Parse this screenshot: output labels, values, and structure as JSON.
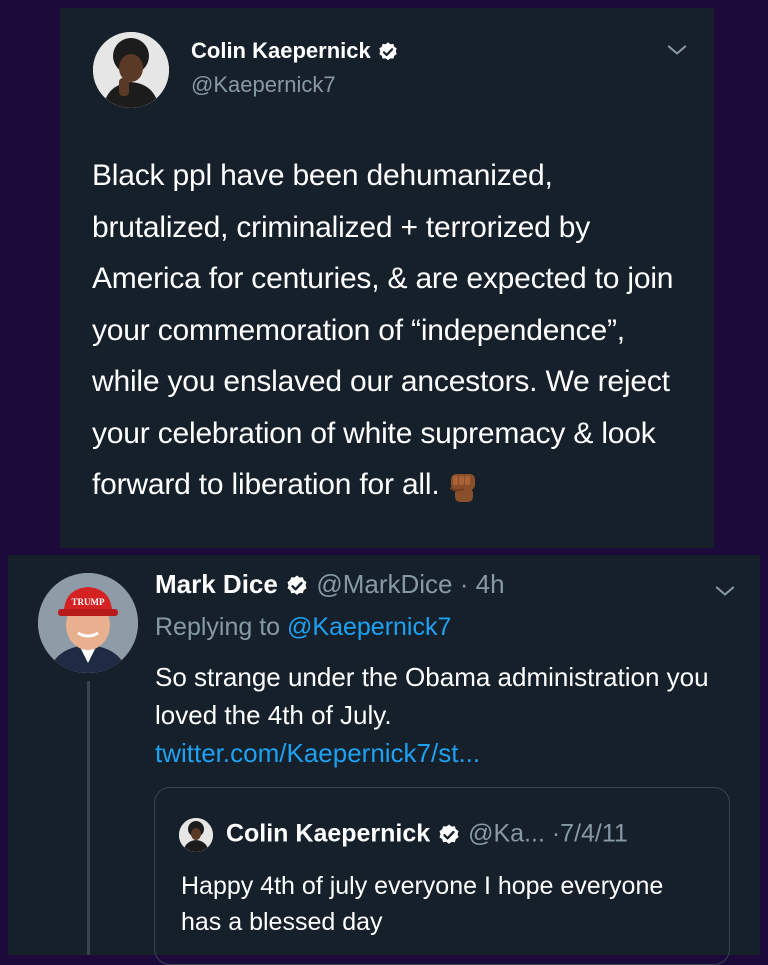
{
  "tweet1": {
    "name": "Colin Kaepernick",
    "handle": "@Kaepernick7",
    "body": "Black ppl have been dehumanized, brutalized, criminalized + terrorized by America for centuries, & are expected to join your commemoration of “independence”, while you enslaved our ancestors. We reject your celebration of white supremacy & look forward to liberation for all.",
    "emoji": "raised-fist-icon"
  },
  "tweet2": {
    "name": "Mark Dice",
    "handle": "@MarkDice",
    "time": "· 4h",
    "replying_prefix": "Replying to ",
    "replying_to": "@Kaepernick7",
    "body": "So strange under the Obama administration you loved the 4th of July.",
    "link": "twitter.com/Kaepernick7/st...",
    "avatar_hat_text": "TRUMP"
  },
  "quote": {
    "name": "Colin Kaepernick",
    "handle": "@Ka...",
    "date": "·7/4/11",
    "body": "Happy 4th of july everyone I hope everyone has a blessed day"
  },
  "colors": {
    "background": "#1b0a3a",
    "card": "#15202b",
    "link": "#1da1f2",
    "secondary_text": "#8899a6",
    "verified": "#ffffff"
  }
}
